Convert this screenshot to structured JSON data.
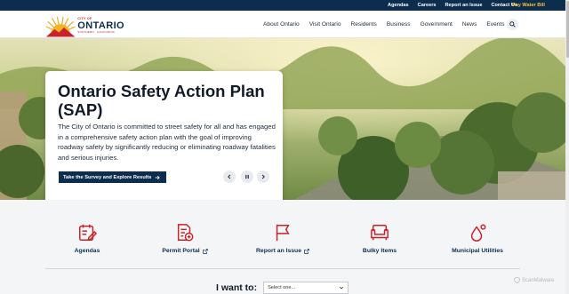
{
  "utility": {
    "links": [
      "Agendas",
      "Careers",
      "Report an Issue",
      "Contact Us"
    ],
    "pay_label": "Pay Water Bill"
  },
  "logo": {
    "city_of": "CITY OF",
    "name": "ONTARIO",
    "tagline": "SOUTHERN · CALIFORNIA"
  },
  "nav": {
    "items": [
      "About Ontario",
      "Visit Ontario",
      "Residents",
      "Business",
      "Government",
      "News",
      "Events"
    ],
    "search_icon": "search-icon"
  },
  "hero": {
    "title": "Ontario Safety Action Plan (SAP)",
    "body": "The City of Ontario is committed to street safety for all and has engaged in a comprehensive safety action plan with the goal of improving roadway safety by significantly reducing or eliminating roadway fatalities and serious injuries.",
    "cta_label": "Take the Survey and Explore Results",
    "controls": [
      "chevron-left-icon",
      "pause-icon",
      "chevron-right-icon"
    ]
  },
  "quick_links": [
    {
      "label": "Agendas",
      "icon": "agenda-icon",
      "external": false
    },
    {
      "label": "Permit Portal",
      "icon": "permit-icon",
      "external": true
    },
    {
      "label": "Report an Issue",
      "icon": "flag-icon",
      "external": true
    },
    {
      "label": "Bulky Items",
      "icon": "couch-icon",
      "external": false
    },
    {
      "label": "Municipal Utilities",
      "icon": "water-drop-icon",
      "external": false
    }
  ],
  "i_want": {
    "label": "I want to:",
    "selected": "Select one..."
  },
  "badge": {
    "text": "ScanMalware"
  },
  "colors": {
    "navy": "#0c2d4e",
    "accent_red": "#c9222a",
    "pay_gold": "#f7c02d",
    "quick_bg": "#f4f5f7"
  }
}
